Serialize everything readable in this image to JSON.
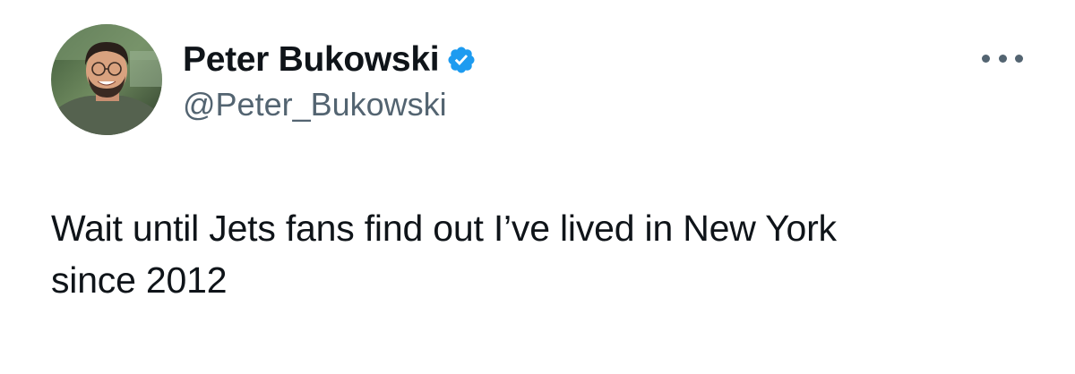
{
  "tweet": {
    "author": {
      "display_name": "Peter Bukowski",
      "handle": "@Peter_Bukowski",
      "verified": true,
      "verified_color": "#1d9bf0"
    },
    "more_icon": "more-horizontal-icon",
    "text_line_1": "Wait until Jets fans find out I’ve lived in New York",
    "text_line_2": "since 2012"
  },
  "colors": {
    "primary_text": "#0f1419",
    "secondary_text": "#536471",
    "background": "#ffffff"
  }
}
